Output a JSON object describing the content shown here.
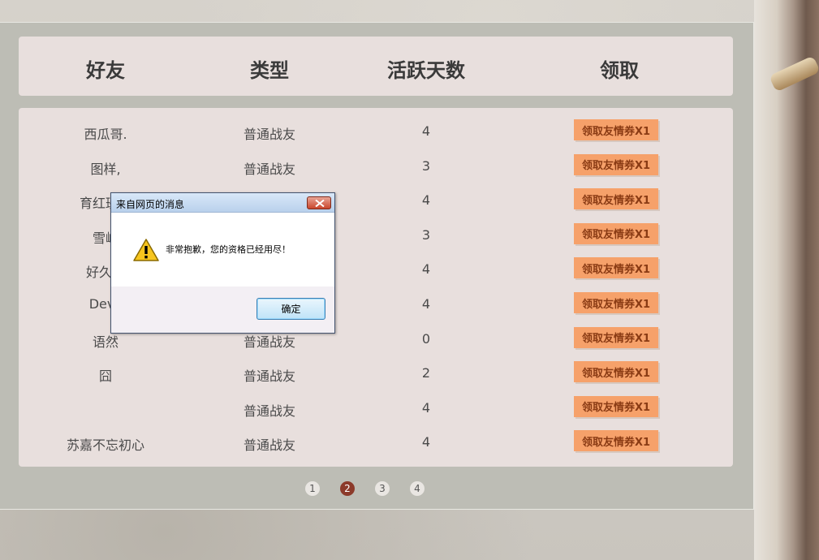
{
  "header": {
    "col_friend": "好友",
    "col_type": "类型",
    "col_days": "活跃天数",
    "col_claim": "领取"
  },
  "rows": [
    {
      "friend": "西瓜哥.",
      "type": "普通战友",
      "days": "4",
      "claim": "领取友情券X1"
    },
    {
      "friend": "图样,",
      "type": "普通战友",
      "days": "3",
      "claim": "领取友情券X1"
    },
    {
      "friend": "育红班小",
      "type": "",
      "days": "4",
      "claim": "领取友情券X1"
    },
    {
      "friend": "雪峰",
      "type": "",
      "days": "3",
      "claim": "领取友情券X1"
    },
    {
      "friend": "好久吖",
      "type": "",
      "days": "4",
      "claim": "领取友情券X1"
    },
    {
      "friend": "Devil",
      "type": "",
      "days": "4",
      "claim": "领取友情券X1"
    },
    {
      "friend": "语然",
      "type": "普通战友",
      "days": "0",
      "claim": "领取友情券X1"
    },
    {
      "friend": "囧",
      "type": "普通战友",
      "days": "2",
      "claim": "领取友情券X1"
    },
    {
      "friend": "",
      "type": "普通战友",
      "days": "4",
      "claim": "领取友情券X1"
    },
    {
      "friend": "苏嘉不忘初心",
      "type": "普通战友",
      "days": "4",
      "claim": "领取友情券X1"
    }
  ],
  "pager": {
    "pages": [
      "1",
      "2",
      "3",
      "4"
    ],
    "current": "2"
  },
  "dialog": {
    "title": "来自网页的消息",
    "message": "非常抱歉，您的资格已经用尽！",
    "ok_label": "确定",
    "icon": "warning-icon"
  },
  "colors": {
    "claim_button": "#f6a16a",
    "active_page": "#8c3a2a",
    "panel": "#bdbdb5",
    "row_bg": "#e8dfdd"
  }
}
